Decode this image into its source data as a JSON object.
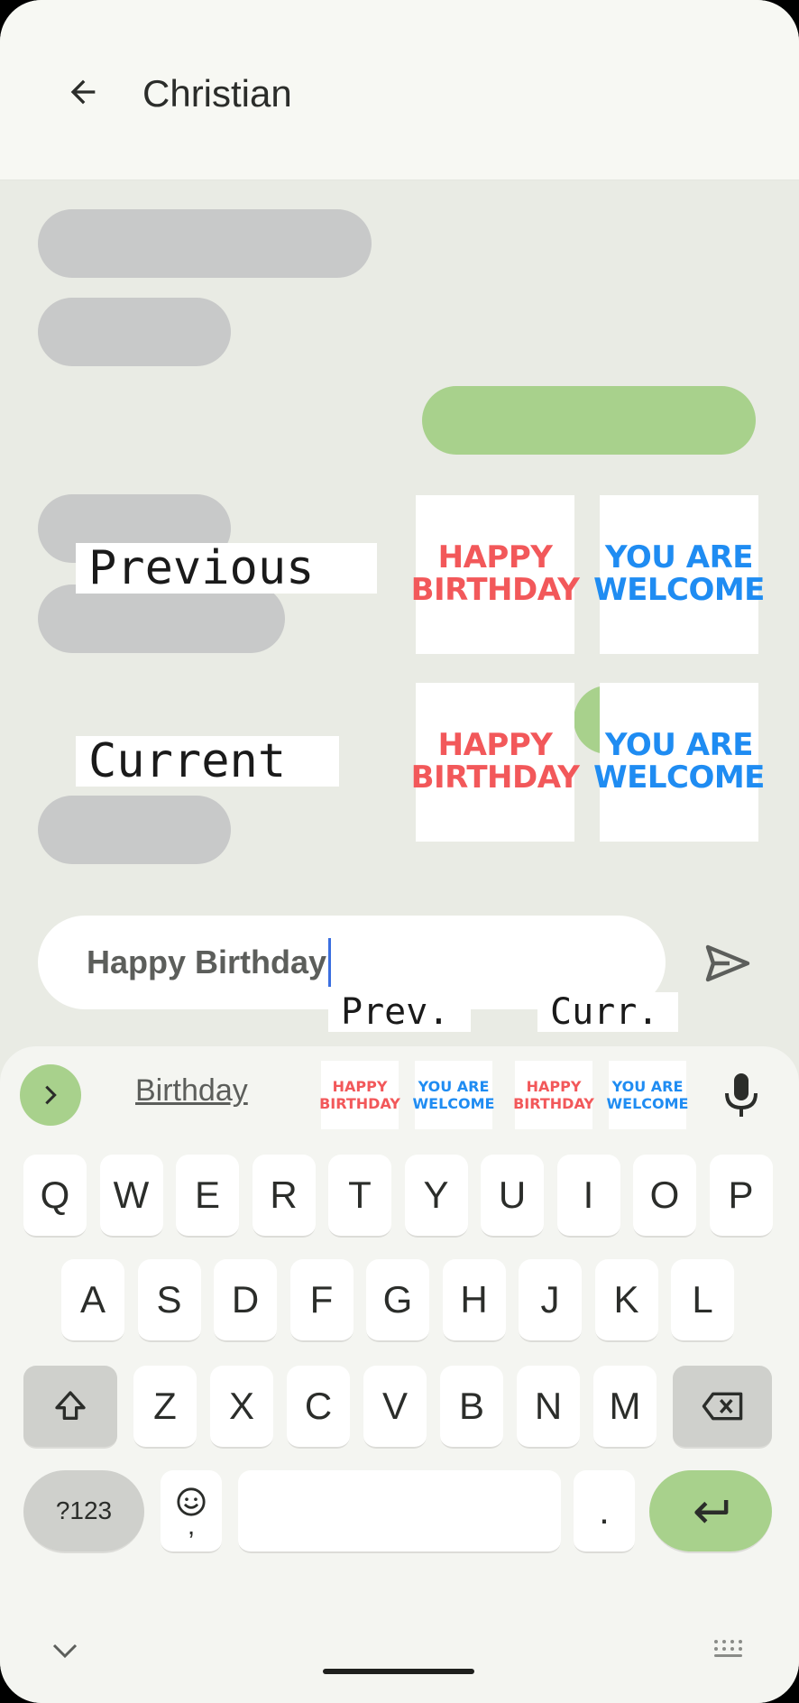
{
  "header": {
    "title": "Christian"
  },
  "labels": {
    "previous": "Previous",
    "current": "Current",
    "prev_short": "Prev.",
    "curr_short": "Curr."
  },
  "stickers": {
    "happy_birthday": {
      "line1": "HAPPY",
      "line2": "BIRTHDAY",
      "color": "#f2585a"
    },
    "you_are_welcome": {
      "line1": "YOU ARE",
      "line2": "WELCOME",
      "color": "#1f8cf2"
    }
  },
  "input": {
    "value": "Happy Birthday"
  },
  "suggestions": {
    "word": "Birthday"
  },
  "keyboard": {
    "row1": [
      "Q",
      "W",
      "E",
      "R",
      "T",
      "Y",
      "U",
      "I",
      "O",
      "P"
    ],
    "row2": [
      "A",
      "S",
      "D",
      "F",
      "G",
      "H",
      "J",
      "K",
      "L"
    ],
    "row3": [
      "Z",
      "X",
      "C",
      "V",
      "B",
      "N",
      "M"
    ],
    "symbols": "?123",
    "emoji_comma": ",",
    "period": "."
  },
  "colors": {
    "accent_green": "#a8d18c",
    "incoming_bubble": "#c8c9c9"
  }
}
